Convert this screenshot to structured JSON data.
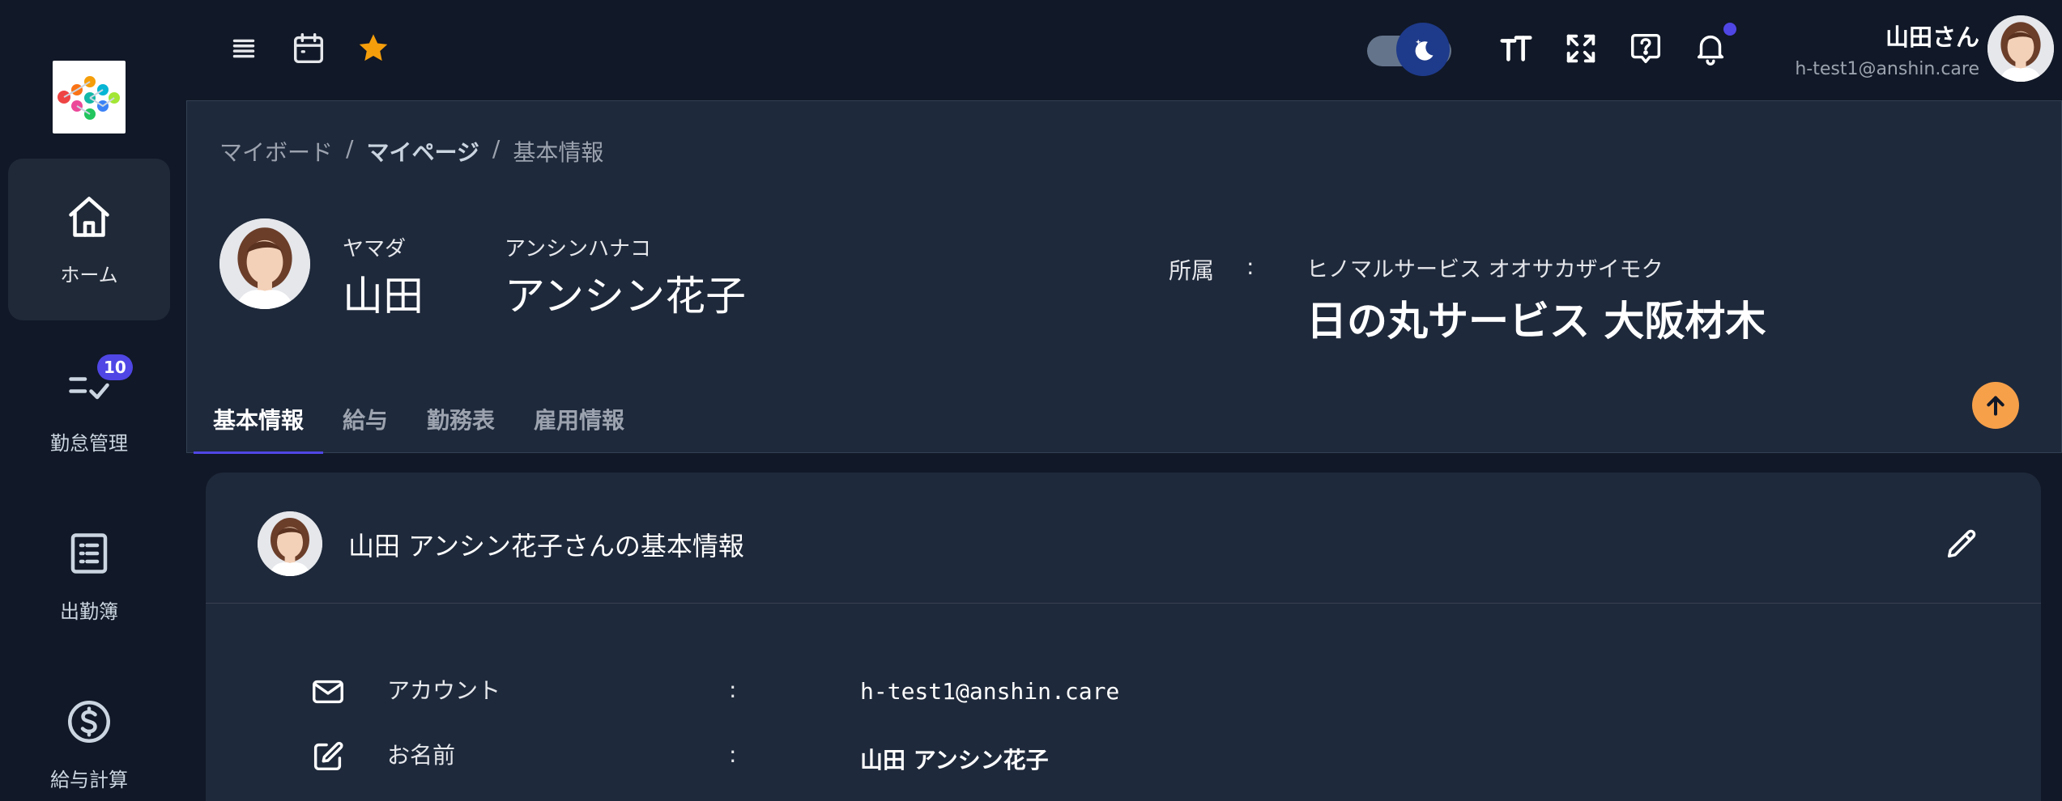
{
  "colors": {
    "background": "#111827",
    "panel": "#1e293b",
    "accent": "#4f46e5",
    "scroll_button": "#f6a04a",
    "star": "#f59e0b",
    "toggle_knob": "#1e3a8a"
  },
  "sidebar": {
    "logo": "colorful-dots-logo",
    "items": [
      {
        "label": "ホーム",
        "icon": "home-icon",
        "active": true
      },
      {
        "label": "勤怠管理",
        "icon": "checklist-icon",
        "badge": "10"
      },
      {
        "label": "出勤簿",
        "icon": "document-list-icon"
      },
      {
        "label": "給与計算",
        "icon": "dollar-icon"
      }
    ]
  },
  "topbar": {
    "left_icons": [
      "menu-icon",
      "calendar-icon",
      "star-icon"
    ],
    "right_icons": [
      "font-size-icon",
      "fullscreen-icon",
      "help-icon",
      "bell-icon"
    ],
    "theme_toggle": "dark",
    "user": {
      "name": "山田さん",
      "email": "h-test1@anshin.care"
    }
  },
  "breadcrumb": {
    "items": [
      "マイボード",
      "マイページ",
      "基本情報"
    ],
    "separator": "/"
  },
  "profile": {
    "last_name_kana": "ヤマダ",
    "last_name": "山田",
    "first_name_kana": "アンシンハナコ",
    "first_name": "アンシン花子",
    "affiliation_label": "所属",
    "colon": ":",
    "affiliation_kana": "ヒノマルサービス オオサカザイモク",
    "affiliation": "日の丸サービス 大阪材木"
  },
  "tabs": [
    {
      "label": "基本情報",
      "active": true
    },
    {
      "label": "給与"
    },
    {
      "label": "勤務表"
    },
    {
      "label": "雇用情報"
    }
  ],
  "card": {
    "title": "山田 アンシン花子さんの基本情報",
    "rows": [
      {
        "icon": "mail-icon",
        "label": "アカウント",
        "colon": ":",
        "value": "h-test1@anshin.care"
      },
      {
        "icon": "edit-icon",
        "label": "お名前",
        "colon": ":",
        "value": "山田 アンシン花子"
      }
    ]
  }
}
